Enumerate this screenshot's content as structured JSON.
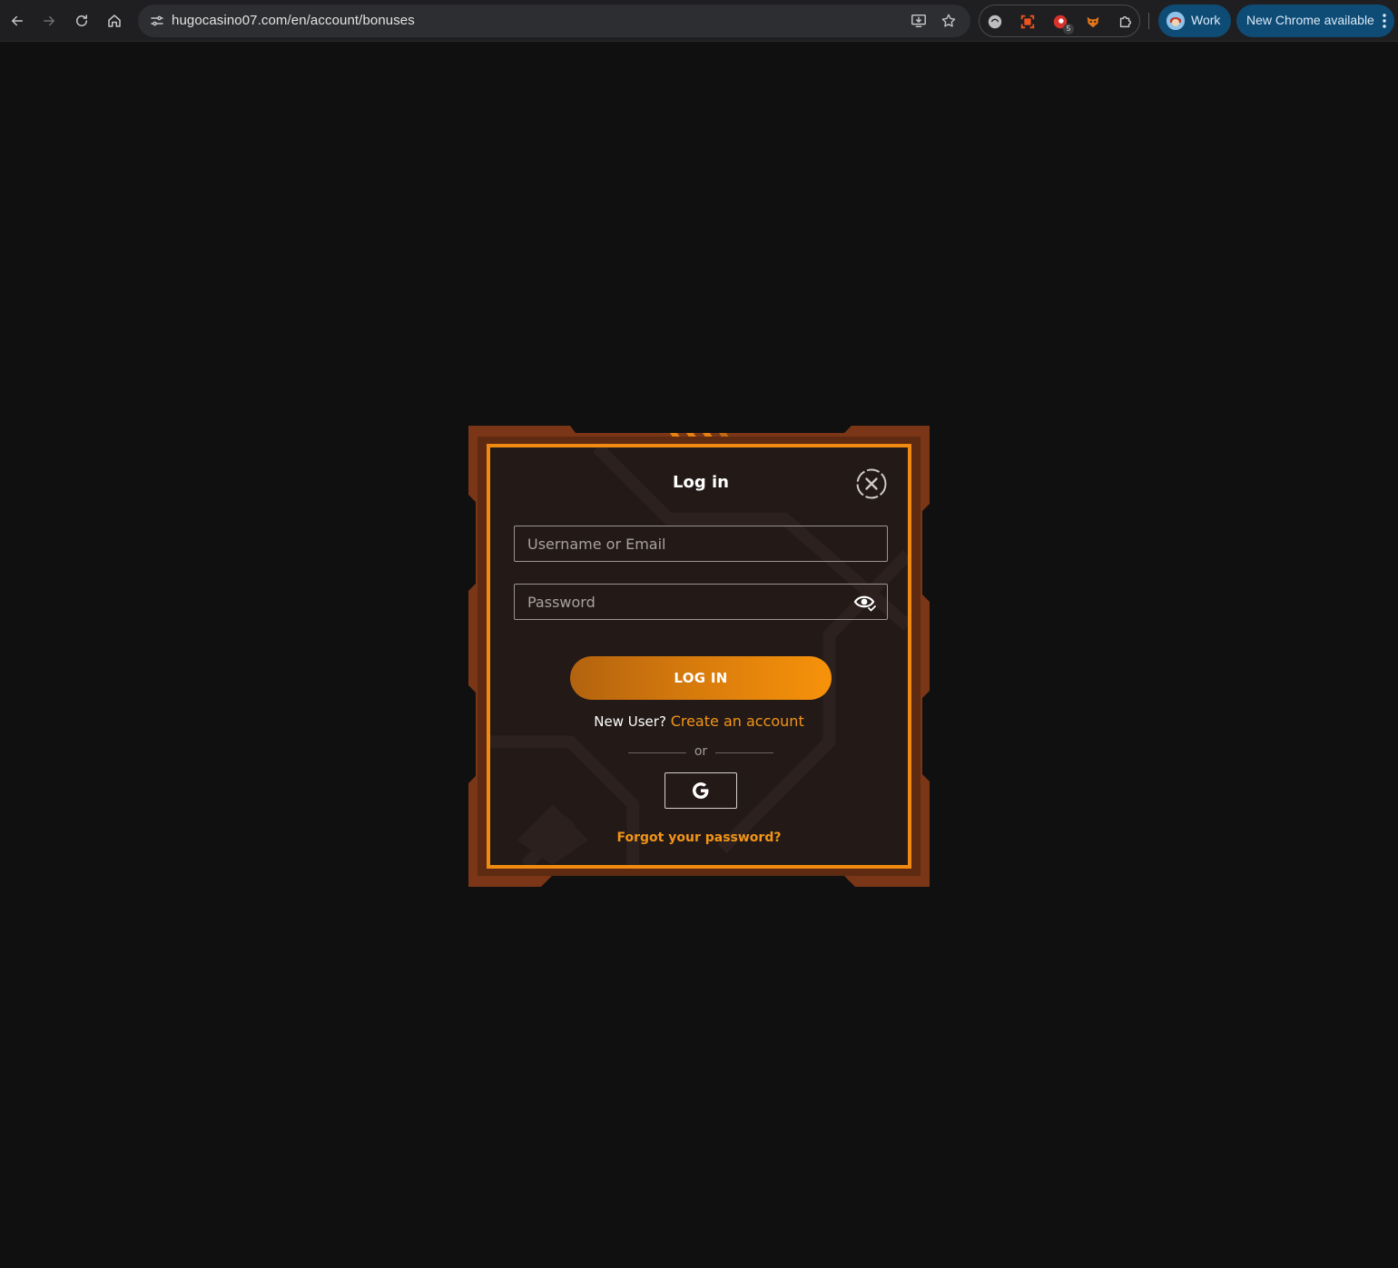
{
  "browser": {
    "url": "hugocasino07.com/en/account/bonuses",
    "profile_label": "Work",
    "update_label": "New Chrome available",
    "extension_badge": "5"
  },
  "login_modal": {
    "title": "Log in",
    "username_placeholder": "Username or Email",
    "password_placeholder": "Password",
    "login_button_label": "LOG IN",
    "new_user_text": "New User?",
    "create_account_link": "Create an account",
    "or_text": "or",
    "forgot_password_link": "Forgot your password?"
  },
  "colors": {
    "page_background": "#101010",
    "frame_outer": "#7a3616",
    "frame_border": "#f08a10",
    "modal_background": "#231a18",
    "accent": "#f39417"
  },
  "icons": {
    "close": "close-circle-icon",
    "password_toggle": "eye-icon",
    "social": "google-icon"
  }
}
